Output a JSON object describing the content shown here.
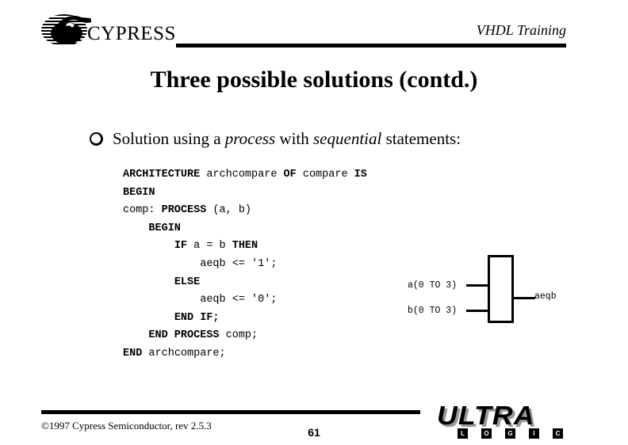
{
  "header": {
    "logo_word": "CYPRESS",
    "logo_mark": "cypress-disc-hand-icon",
    "title": "VHDL Training"
  },
  "slide": {
    "title": "Three possible solutions (contd.)",
    "bullet": {
      "glyph": "hollow-circle-bullet",
      "text_before": "Solution using a ",
      "italic_1": "process",
      "text_middle": " with ",
      "italic_2": "sequential",
      "text_after": " statements:"
    }
  },
  "code": {
    "lines": [
      [
        {
          "t": "ARCHITECTURE",
          "b": true
        },
        {
          "t": " archcompare ",
          "b": false
        },
        {
          "t": "OF",
          "b": true
        },
        {
          "t": " compare ",
          "b": false
        },
        {
          "t": "IS",
          "b": true
        }
      ],
      [
        {
          "t": "BEGIN",
          "b": true
        }
      ],
      [
        {
          "t": "comp: ",
          "b": false
        },
        {
          "t": "PROCESS",
          "b": true
        },
        {
          "t": " (a, b)",
          "b": false
        }
      ],
      [
        {
          "t": "    ",
          "b": false
        },
        {
          "t": "BEGIN",
          "b": true
        }
      ],
      [
        {
          "t": "        ",
          "b": false
        },
        {
          "t": "IF",
          "b": true
        },
        {
          "t": " a = b ",
          "b": false
        },
        {
          "t": "THEN",
          "b": true
        }
      ],
      [
        {
          "t": "            aeqb <= '1';",
          "b": false
        }
      ],
      [
        {
          "t": "        ",
          "b": false
        },
        {
          "t": "ELSE",
          "b": true
        }
      ],
      [
        {
          "t": "            aeqb <= '0';",
          "b": false
        }
      ],
      [
        {
          "t": "        ",
          "b": false
        },
        {
          "t": "END IF;",
          "b": true
        }
      ],
      [
        {
          "t": "    ",
          "b": false
        },
        {
          "t": "END PROCESS",
          "b": true
        },
        {
          "t": " comp;",
          "b": false
        }
      ],
      [
        {
          "t": "END",
          "b": true
        },
        {
          "t": " archcompare;",
          "b": false
        }
      ]
    ]
  },
  "schematic": {
    "input_a": "a(0 TO 3)",
    "input_b": "b(0 TO 3)",
    "output": "aeqb"
  },
  "footer": {
    "copyright": "©1997 Cypress Semiconductor, rev 2.5.3",
    "page_number": "61",
    "logo_word": "ULTRA",
    "logo_sub": [
      "L",
      "O",
      "G",
      "I",
      "C"
    ]
  }
}
